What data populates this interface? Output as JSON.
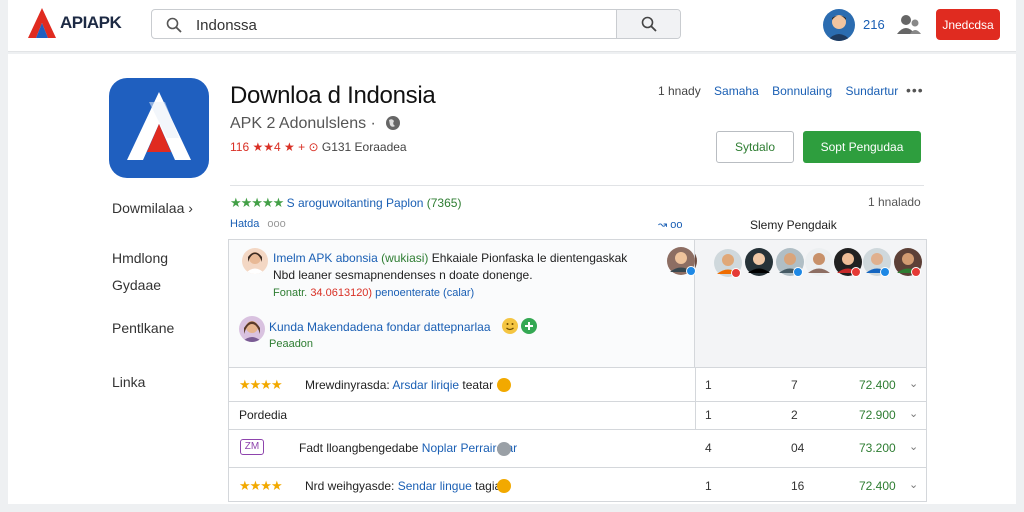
{
  "topbar": {
    "logo_text": "APIAPK",
    "search_value": "Indonssa",
    "count": "216",
    "cta_label": "Jnedcdsa"
  },
  "app": {
    "title": "Downloa d Indonsia",
    "subtitle": "APK 2 Adonulslens ·",
    "meta_rating": "116",
    "meta_stars": "★★4 ★",
    "meta_arrow": "+ ⊙",
    "meta_text": "G131 Eoraadea",
    "header_prefix": "1 hnady",
    "header_links": [
      "Samaha",
      "Bonnulaing",
      "Sundartur"
    ],
    "more": "•••",
    "btn_outline": "Sytdalo",
    "btn_primary": "Sopt Pengudaa"
  },
  "sidebar": {
    "items": [
      "Dowmilalaa ›",
      "Hmdlong",
      "Gydaae",
      "Pentlkane",
      "Linka"
    ]
  },
  "summary": {
    "stars": "★★★★★",
    "text": "S aroguwoitanting",
    "link": "Paplon",
    "count": "(7365)",
    "right_count": "1 hnalado",
    "sub_left": "Hatda",
    "sub_left_muted": "ooo",
    "sub_mid": "↝ oo",
    "sub_head": "Slemy Pengdaik"
  },
  "comments": [
    {
      "title": "Imelm APK",
      "title_2": "abonsia",
      "title_3": "(wukiasi)",
      "title_4": "Ehkaiale Pionfaska le dientengaskak",
      "line2": "Nbd leaner sesmapnendenses n doate donenge.",
      "meta_left": "Fonatr.",
      "meta_num": "34.0613120)",
      "meta_right": "penoenterate (calar)"
    },
    {
      "title": "Kunda Makendadena",
      "title_2": "fondar dattepnarlaa",
      "meta": "Peaadon"
    }
  ],
  "rows": [
    {
      "stars": "★★★★",
      "label": "Mrewdinyrasda:",
      "link": "Arsdar liriqie",
      "tail": "teatar",
      "c1": "1",
      "c2": "7",
      "c3": "72.400",
      "circle": "#f2a900"
    },
    {
      "plain": "Pordedia",
      "c1": "1",
      "c2": "2",
      "c3": "72.900"
    },
    {
      "badge": "ZM",
      "label": "Fadt lloangbengedabe",
      "link": "Noplar Perrairotar",
      "tail": "",
      "c1": "4",
      "c2": "04",
      "c3": "73.200",
      "circle": "#9aa0a6"
    },
    {
      "stars": "★★★★",
      "label": "Nrd weihgyasde:",
      "link": "Sendar lingue",
      "tail": "tagiar",
      "c1": "1",
      "c2": "16",
      "c3": "72.400",
      "circle": "#f2a900"
    }
  ],
  "colors": {
    "brand_red": "#e02b20",
    "primary_green": "#2e9e3e",
    "link_blue": "#1a5fb4",
    "app_icon_blue": "#1f5fbf"
  }
}
